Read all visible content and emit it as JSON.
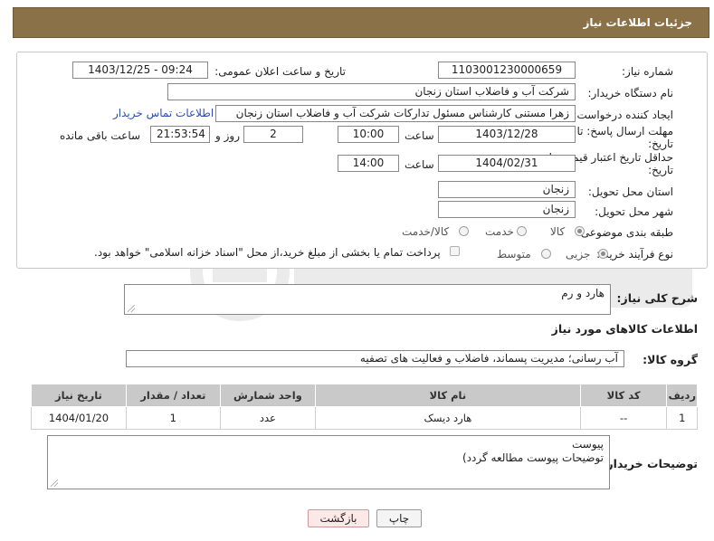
{
  "header": {
    "title": "جزئیات اطلاعات نیاز"
  },
  "fields": {
    "need_number_label": "شماره نیاز:",
    "need_number": "1103001230000659",
    "announce_label": "تاریخ و ساعت اعلان عمومی:",
    "announce_value": "1403/12/25 - 09:24",
    "buyer_label": "نام دستگاه خریدار:",
    "buyer_value": "شرکت آب و فاضلاب استان زنجان",
    "creator_label": "ایجاد کننده درخواست:",
    "creator_value": "زهرا مستنی کارشناس مسئول تدارکات شرکت آب و فاضلاب استان زنجان",
    "contact_link": "اطلاعات تماس خریدار",
    "reply_deadline_label_1": "مهلت ارسال پاسخ: تا",
    "reply_deadline_label_2": "تاریخ:",
    "reply_date": "1403/12/28",
    "time_label": "ساعت",
    "reply_time": "10:00",
    "days_value": "2",
    "days_label": "روز و",
    "remaining_value": "21:53:54",
    "remaining_label": "ساعت باقی مانده",
    "price_validity_label_1": "حداقل تاریخ اعتبار قیمت: تا",
    "price_validity_label_2": "تاریخ:",
    "price_date": "1404/02/31",
    "price_time": "14:00",
    "province_label": "استان محل تحویل:",
    "province_value": "زنجان",
    "city_label": "شهر محل تحویل:",
    "city_value": "زنجان",
    "category_label": "طبقه بندی موضوعی:",
    "category_options": [
      "کالا",
      "خدمت",
      "کالا/خدمت"
    ],
    "process_label": "نوع فرآیند خرید :",
    "process_options": [
      "جزیی",
      "متوسط"
    ],
    "payment_note": "پرداخت تمام یا بخشی از مبلغ خرید،از محل \"اسناد خزانه اسلامی\" خواهد بود."
  },
  "summary": {
    "label": "شرح کلی نیاز:",
    "value": "هارد و رم"
  },
  "goods_info": {
    "title": "اطلاعات کالاهای مورد نیاز",
    "group_label": "گروه کالا:",
    "group_value": "آب رسانی؛ مدیریت پسماند، فاضلاب و فعالیت های تصفیه"
  },
  "table": {
    "headers": [
      "ردیف",
      "کد کالا",
      "نام کالا",
      "واحد شمارش",
      "تعداد / مقدار",
      "تاریخ نیاز"
    ],
    "rows": [
      [
        "1",
        "--",
        "هارد دیسک",
        "عدد",
        "1",
        "1404/01/20"
      ]
    ]
  },
  "buyer_notes": {
    "label": "توضیحات خریدار:",
    "line1": "پیوست",
    "line2": "توضیحات پیوست مطالعه گردد)"
  },
  "buttons": {
    "print": "چاپ",
    "back": "بازگشت"
  },
  "colors": {
    "header_bg": "#8b7148",
    "link": "#2a4fb0",
    "table_header": "#c9c9c9"
  }
}
